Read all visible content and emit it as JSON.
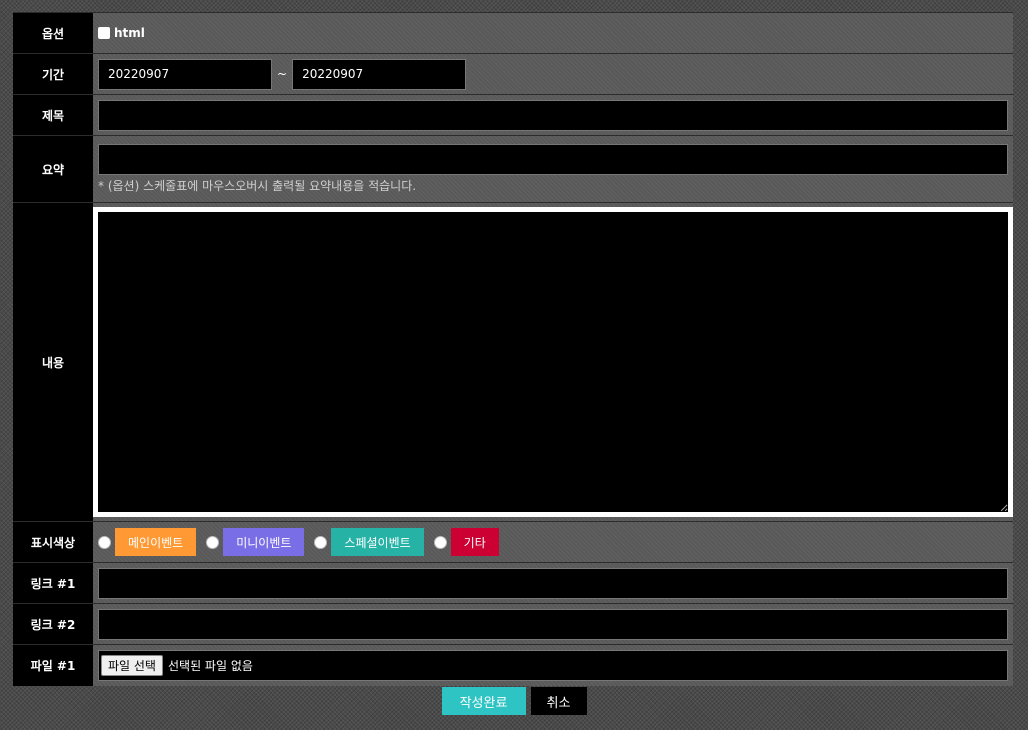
{
  "labels": {
    "option": "옵션",
    "period": "기간",
    "title": "제목",
    "summary": "요약",
    "content": "내용",
    "display_color": "표시색상",
    "link1": "링크 #1",
    "link2": "링크 #2",
    "file1": "파일 #1"
  },
  "option": {
    "html_label": "html",
    "html_checked": false
  },
  "period": {
    "start": "20220907",
    "separator": "~",
    "end": "20220907"
  },
  "title_value": "",
  "summary": {
    "value": "",
    "note": "* (옵션) 스케줄표에 마우스오버시 출력될 요약내용을 적습니다."
  },
  "content_value": "",
  "display_colors": [
    {
      "label": "메인이벤트",
      "color": "#ff9933"
    },
    {
      "label": "미니이벤트",
      "color": "#7a6ee6"
    },
    {
      "label": "스페셜이벤트",
      "color": "#26b3a6"
    },
    {
      "label": "기타",
      "color": "#cc0033"
    }
  ],
  "link1_value": "",
  "link2_value": "",
  "file1": {
    "button_label": "파일 선택",
    "status": "선택된 파일 없음"
  },
  "buttons": {
    "submit": "작성완료",
    "cancel": "취소"
  },
  "icons": {
    "checkbox": "checkbox-icon",
    "radio": "radio-icon"
  }
}
